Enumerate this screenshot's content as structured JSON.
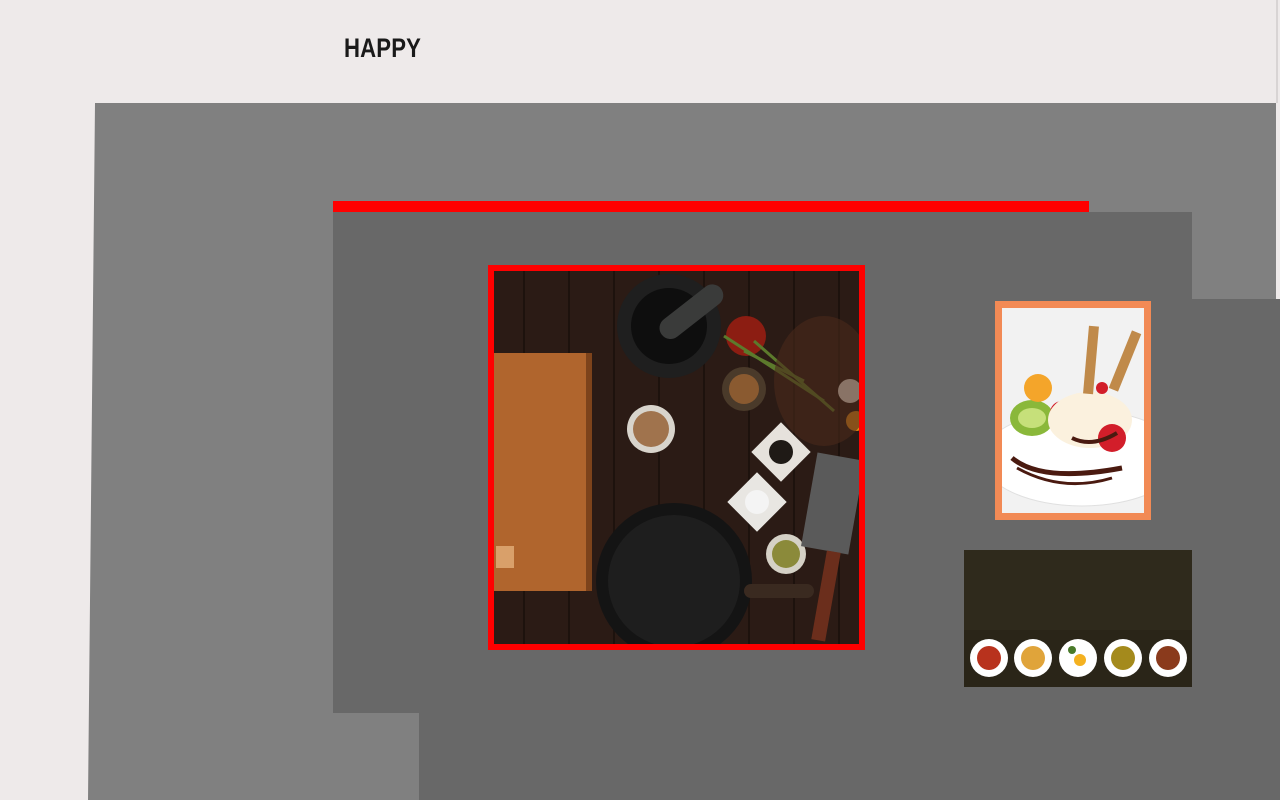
{
  "header": {
    "logo_text": "HAPPY"
  },
  "colors": {
    "page_background": "#eeeaea",
    "panel_light_grey": "#808080",
    "panel_dark_grey": "#686868",
    "accent_red": "#ff0000",
    "dessert_frame_orange": "#f28a55"
  },
  "images": {
    "main": "cooking-ingredients-flatlay-image",
    "dessert": "ice-cream-dessert-image",
    "plates": "five-dishes-on-dark-background-image"
  }
}
